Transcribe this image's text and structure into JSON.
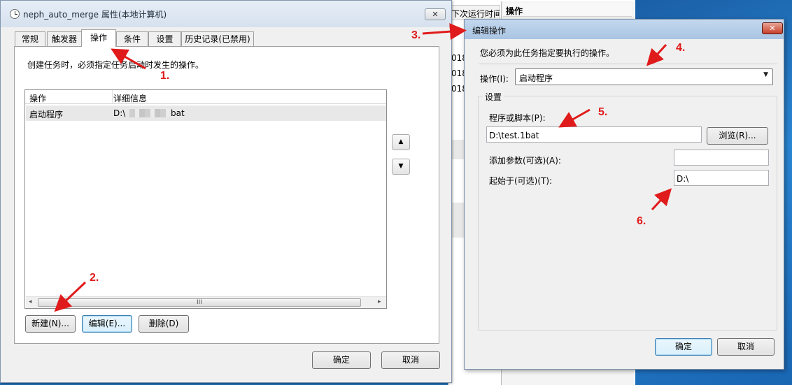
{
  "background": {
    "partial_header": "下次运行时间",
    "panel_header": "操作",
    "partial_digits": [
      "018",
      "018",
      "018"
    ]
  },
  "main_window": {
    "title": "neph_auto_merge 属性(本地计算机)",
    "close_glyph": "✕",
    "tabs": [
      {
        "label": "常规"
      },
      {
        "label": "触发器"
      },
      {
        "label": "操作"
      },
      {
        "label": "条件"
      },
      {
        "label": "设置"
      },
      {
        "label": "历史记录(已禁用)"
      }
    ],
    "active_tab": "操作",
    "instruction": "创建任务时，必须指定任务启动时发生的操作。",
    "list": {
      "columns": [
        "操作",
        "详细信息"
      ],
      "rows": [
        {
          "action": "启动程序",
          "detail_prefix": "D:\\",
          "detail_suffix": "bat"
        }
      ],
      "scroll_thumb_glyph": "III"
    },
    "move_up_glyph": "▲",
    "move_down_glyph": "▼",
    "buttons": {
      "new": "新建(N)...",
      "edit": "编辑(E)...",
      "delete": "删除(D)",
      "ok": "确定",
      "cancel": "取消"
    }
  },
  "edit_dialog": {
    "title": "编辑操作",
    "close_glyph": "✕",
    "note": "您必须为此任务指定要执行的操作。",
    "action_label": "操作(I):",
    "action_value": "启动程序",
    "settings_group": "设置",
    "program_label": "程序或脚本(P):",
    "program_value": "D:\\test.1bat",
    "browse_button": "浏览(R)...",
    "args_label": "添加参数(可选)(A):",
    "args_value": "",
    "start_label": "起始于(可选)(T):",
    "start_value": "D:\\",
    "ok": "确定",
    "cancel": "取消"
  },
  "annotations": [
    "1.",
    "2.",
    "3.",
    "4.",
    "5.",
    "6."
  ],
  "colors": {
    "annotation": "#e01b1b",
    "edit_title_bar": "#a9c4e2",
    "close_button_red": "#c7402b",
    "desktop": "#1f6fb5"
  }
}
